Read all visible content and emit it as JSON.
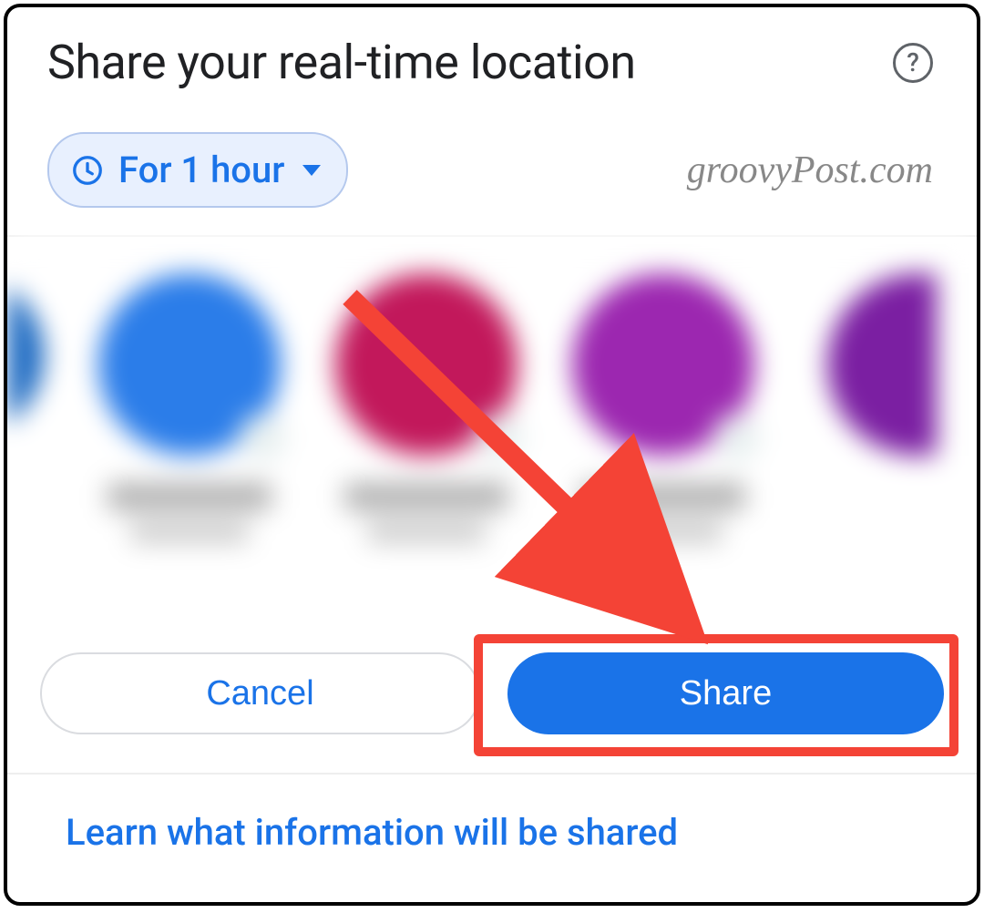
{
  "header": {
    "title": "Share your real-time location",
    "help_icon": "?"
  },
  "duration": {
    "label": "For 1 hour"
  },
  "watermark": "groovyPost.com",
  "contacts": [
    {
      "color": "#1565c0"
    },
    {
      "color": "#2b7de9"
    },
    {
      "color": "#c2185b"
    },
    {
      "color": "#9c27b0"
    },
    {
      "color": "#7b1fa2"
    }
  ],
  "actions": {
    "cancel_label": "Cancel",
    "share_label": "Share"
  },
  "footer": {
    "learn_link": "Learn what information will be shared"
  },
  "annotation": {
    "highlight_target": "share-button",
    "arrow_color": "#f44336"
  }
}
